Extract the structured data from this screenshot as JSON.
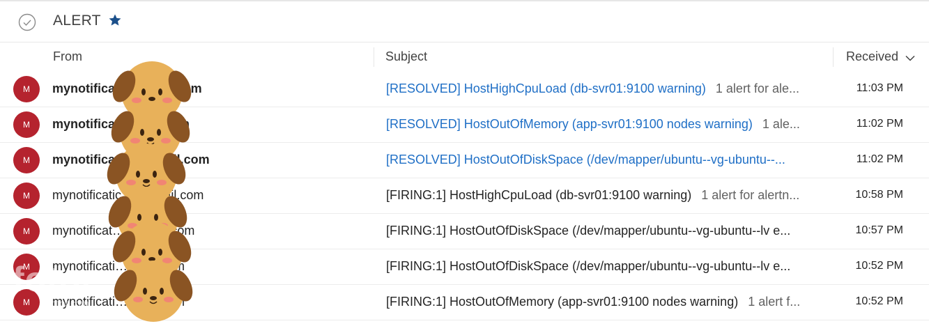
{
  "header": {
    "folder_title": "ALERT"
  },
  "columns": {
    "from": "From",
    "subject": "Subject",
    "received": "Received"
  },
  "messages": [
    {
      "avatar": "M",
      "from": "mynotifica…@gmail.com",
      "subject": "[RESOLVED] HostHighCpuLoad (db-svr01:9100 warning)",
      "preview": "1 alert for ale...",
      "time": "11:03 PM",
      "unread": true
    },
    {
      "avatar": "M",
      "from": "mynotifica…gmail.com",
      "subject": "[RESOLVED] HostOutOfMemory (app-svr01:9100 nodes warning)",
      "preview": "1 ale...",
      "time": "11:02 PM",
      "unread": true
    },
    {
      "avatar": "M",
      "from": "mynotificati…@gmail.com",
      "subject": "[RESOLVED] HostOutOfDiskSpace (/dev/mapper/ubuntu--vg-ubuntu--...",
      "preview": "",
      "time": "11:02 PM",
      "unread": true
    },
    {
      "avatar": "M",
      "from": "mynotificatic…@gmail.com",
      "subject": "[FIRING:1] HostHighCpuLoad (db-svr01:9100 warning)",
      "preview": "1 alert for alertn...",
      "time": "10:58 PM",
      "unread": false
    },
    {
      "avatar": "M",
      "from": "mynotificat…@gmail.com",
      "subject": "[FIRING:1] HostOutOfDiskSpace (/dev/mapper/ubuntu--vg-ubuntu--lv e...",
      "preview": "",
      "time": "10:57 PM",
      "unread": false
    },
    {
      "avatar": "M",
      "from": "mynotificati…gmail.com",
      "subject": "[FIRING:1] HostOutOfDiskSpace (/dev/mapper/ubuntu--vg-ubuntu--lv e...",
      "preview": "",
      "time": "10:52 PM",
      "unread": false
    },
    {
      "avatar": "M",
      "from": "mynotificati…gmail.com",
      "subject": "[FIRING:1] HostOutOfMemory (app-svr01:9100 nodes warning)",
      "preview": "1 alert f...",
      "time": "10:52 PM",
      "unread": false
    }
  ],
  "watermark": {
    "brand": "fotor",
    "site": "fotor.com"
  },
  "colors": {
    "avatar": "#b5232e",
    "unread_subject": "#1f6fc6",
    "star": "#1b4f8a",
    "sticker": "#e8b15a",
    "sticker_ear": "#8a5423"
  }
}
